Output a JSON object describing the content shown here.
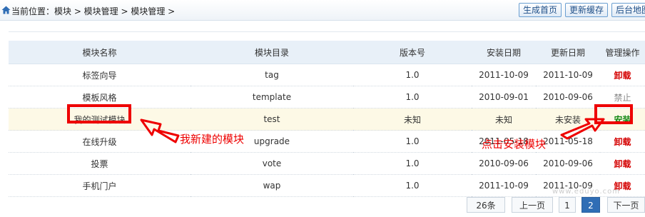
{
  "breadcrumb": {
    "text": "当前位置：模块 > 模块管理 > 模块管理 >"
  },
  "toolbar": {
    "generate_home": "生成首页",
    "update_cache": "更新缓存",
    "backend_map": "后台地图"
  },
  "table": {
    "headers": [
      "模块名称",
      "模块目录",
      "版本号",
      "安装日期",
      "更新日期",
      "管理操作"
    ],
    "rows": [
      {
        "name": "标签向导",
        "dir": "tag",
        "version": "1.0",
        "install_date": "2011-10-09",
        "update_date": "2011-10-09",
        "action": "卸载"
      },
      {
        "name": "模板风格",
        "dir": "template",
        "version": "1.0",
        "install_date": "2010-09-01",
        "update_date": "2010-09-06",
        "action": "禁止"
      },
      {
        "name": "我的测试模块",
        "dir": "test",
        "version": "未知",
        "install_date": "未知",
        "update_date": "未安装",
        "action": "安装"
      },
      {
        "name": "在线升级",
        "dir": "upgrade",
        "version": "1.0",
        "install_date": "2011-05-18",
        "update_date": "2011-05-18",
        "action": "卸载"
      },
      {
        "name": "投票",
        "dir": "vote",
        "version": "1.0",
        "install_date": "2010-09-06",
        "update_date": "2010-09-06",
        "action": "卸载"
      },
      {
        "name": "手机门户",
        "dir": "wap",
        "version": "1.0",
        "install_date": "2011-10-09",
        "update_date": "2011-10-09",
        "action": "卸载"
      }
    ]
  },
  "annotations": {
    "new_module": "我新建的模块",
    "click_install": "点击安装模块"
  },
  "pagination": {
    "total": "26条",
    "prev": "上一页",
    "page1": "1",
    "page2": "2",
    "next": "下一页"
  },
  "watermark": "www.eduyo.com",
  "colors": {
    "accent": "#2f6db5",
    "annotation": "#e00000",
    "uninstall": "#d40000",
    "install": "#118811"
  }
}
